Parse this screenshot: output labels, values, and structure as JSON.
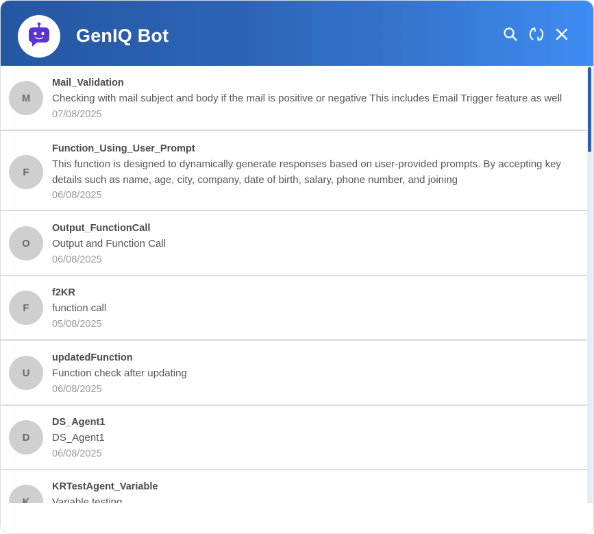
{
  "header": {
    "title": "GenIQ Bot",
    "icons": [
      "search-icon",
      "refresh-icon",
      "close-icon"
    ]
  },
  "colors": {
    "header_start": "#2457a3",
    "header_end": "#3e8cf2",
    "bot_accent": "#5b32d6",
    "avatar_bg": "#cfcfcf",
    "scroll_thumb": "#2e62b0"
  },
  "items": [
    {
      "initial": "M",
      "name": "Mail_Validation",
      "description": "Checking with mail subject and body if the mail is positive or negative This includes Email Trigger feature as well",
      "date": "07/08/2025"
    },
    {
      "initial": "F",
      "name": "Function_Using_User_Prompt",
      "description": "This function is designed to dynamically generate responses based on user-provided prompts. By accepting key details such as name, age, city, company, date of birth, salary, phone number, and joining",
      "date": "06/08/2025"
    },
    {
      "initial": "O",
      "name": "Output_FunctionCall",
      "description": "Output and Function Call",
      "date": "06/08/2025"
    },
    {
      "initial": "F",
      "name": "f2KR",
      "description": "function call",
      "date": "05/08/2025"
    },
    {
      "initial": "U",
      "name": "updatedFunction",
      "description": "Function check after updating",
      "date": "06/08/2025"
    },
    {
      "initial": "D",
      "name": "DS_Agent1",
      "description": "DS_Agent1",
      "date": "06/08/2025"
    },
    {
      "initial": "K",
      "name": "KRTestAgent_Variable",
      "description": "Variable testing",
      "date": ""
    }
  ]
}
